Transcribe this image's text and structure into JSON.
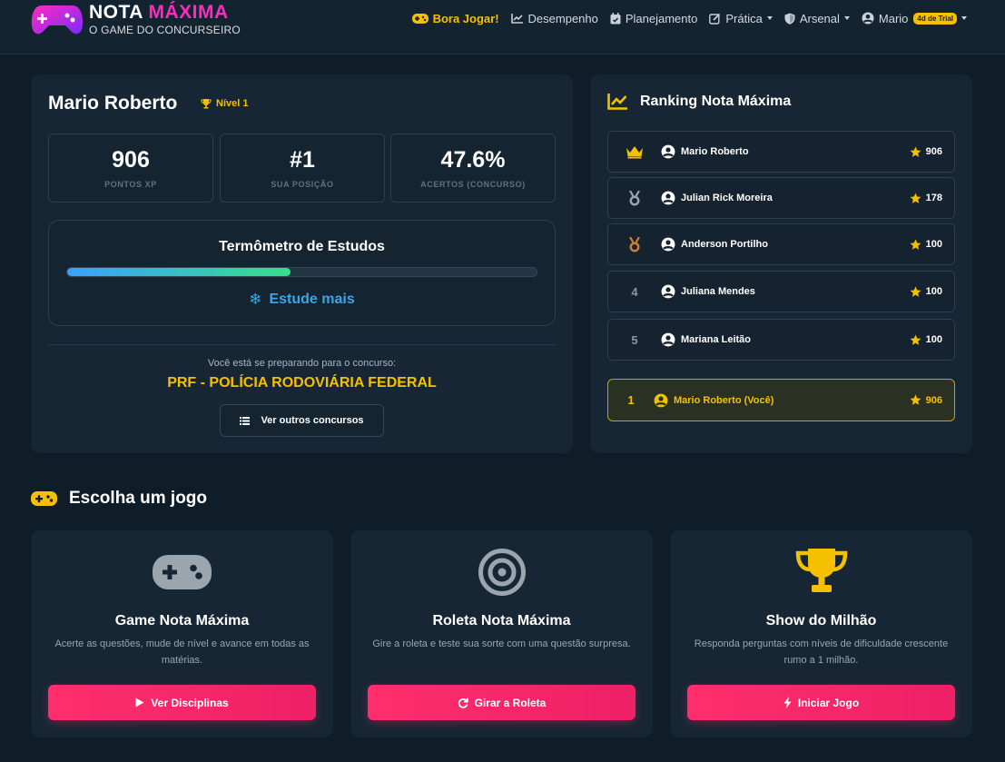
{
  "navbar": {
    "logo_word1": "NOTA",
    "logo_word2": "MÁXIMA",
    "logo_subtitle": "O GAME DO CONCURSEIRO",
    "items": [
      {
        "label": "Bora Jogar!",
        "icon": "gamepad-icon"
      },
      {
        "label": "Desempenho",
        "icon": "chart-line-icon"
      },
      {
        "label": "Planejamento",
        "icon": "calendar-icon"
      },
      {
        "label": "Prática",
        "icon": "edit-icon"
      },
      {
        "label": "Arsenal",
        "icon": "shield-icon"
      },
      {
        "label": "Mario",
        "icon": "user-circle-icon"
      }
    ],
    "trial_badge": "4d de Trial"
  },
  "profile": {
    "name": "Mario Roberto",
    "level": "Nível 1",
    "stats": [
      {
        "value": "906",
        "label": "PONTOS XP"
      },
      {
        "value": "#1",
        "label": "SUA POSIÇÃO"
      },
      {
        "value": "47.6%",
        "label": "ACERTOS (CONCURSO)"
      }
    ],
    "thermometer": {
      "title": "Termômetro de Estudos",
      "fill_percent": 47.6,
      "status": "Estude mais"
    },
    "prep_text": "Você está se preparando para o concurso:",
    "contest": "PRF - POLÍCIA RODOVIÁRIA FEDERAL",
    "other_contests_button": "Ver outros concursos"
  },
  "ranking": {
    "title": "Ranking Nota Máxima",
    "rows": [
      {
        "pos": "",
        "medal": "crown-icon",
        "name": "Mario Roberto",
        "score": "906"
      },
      {
        "pos": "",
        "medal": "silver-medal-icon",
        "name": "Julian Rick Moreira",
        "score": "178"
      },
      {
        "pos": "",
        "medal": "bronze-medal-icon",
        "name": "Anderson Portilho",
        "score": "100"
      },
      {
        "pos": "4",
        "medal": "",
        "name": "Juliana Mendes",
        "score": "100"
      },
      {
        "pos": "5",
        "medal": "",
        "name": "Mariana Leitão",
        "score": "100"
      }
    ],
    "me": {
      "pos": "1",
      "name": "Mario Roberto (Você)",
      "score": "906"
    }
  },
  "games": {
    "section_title": "Escolha um jogo",
    "cards": [
      {
        "title": "Game Nota Máxima",
        "description": "Acerte as questões, mude de nível e avance em todas as matérias.",
        "button": "Ver Disciplinas",
        "icon": "gamepad-icon"
      },
      {
        "title": "Roleta Nota Máxima",
        "description": "Gire a roleta e teste sua sorte com uma questão surpresa.",
        "button": "Girar a Roleta",
        "icon": "target-icon"
      },
      {
        "title": "Show do Milhão",
        "description": "Responda perguntas com níveis de dificuldade crescente rumo a 1 milhão.",
        "button": "Iniciar Jogo",
        "icon": "trophy-icon"
      }
    ]
  },
  "colors": {
    "accent_yellow": "#f5c000",
    "accent_pink": "#ff2f6d",
    "background": "#0f1d29",
    "card": "#172634"
  }
}
